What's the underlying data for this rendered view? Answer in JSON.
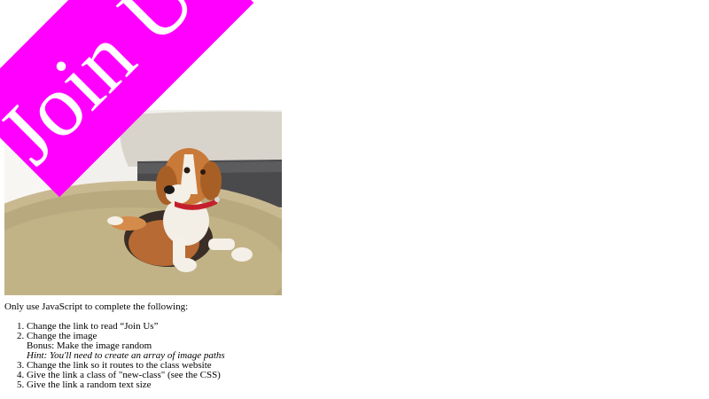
{
  "link": {
    "text": "Join Us",
    "color": "#ff00ff",
    "text_color": "#ffffff"
  },
  "image": {
    "subject": "beagle lying on rug"
  },
  "instructions": {
    "intro": "Only use JavaScript to complete the following:",
    "tasks": [
      {
        "label": "Change the link to read “Join Us”"
      },
      {
        "label": "Change the image",
        "sub": "Bonus: Make the image random",
        "hint": "Hint: You'll need to create an array of image paths"
      },
      {
        "label": "Change the link so it routes to the class website"
      },
      {
        "label": "Give the link a class of \"new-class\" (see the CSS)"
      },
      {
        "label": "Give the link a random text size"
      }
    ]
  }
}
